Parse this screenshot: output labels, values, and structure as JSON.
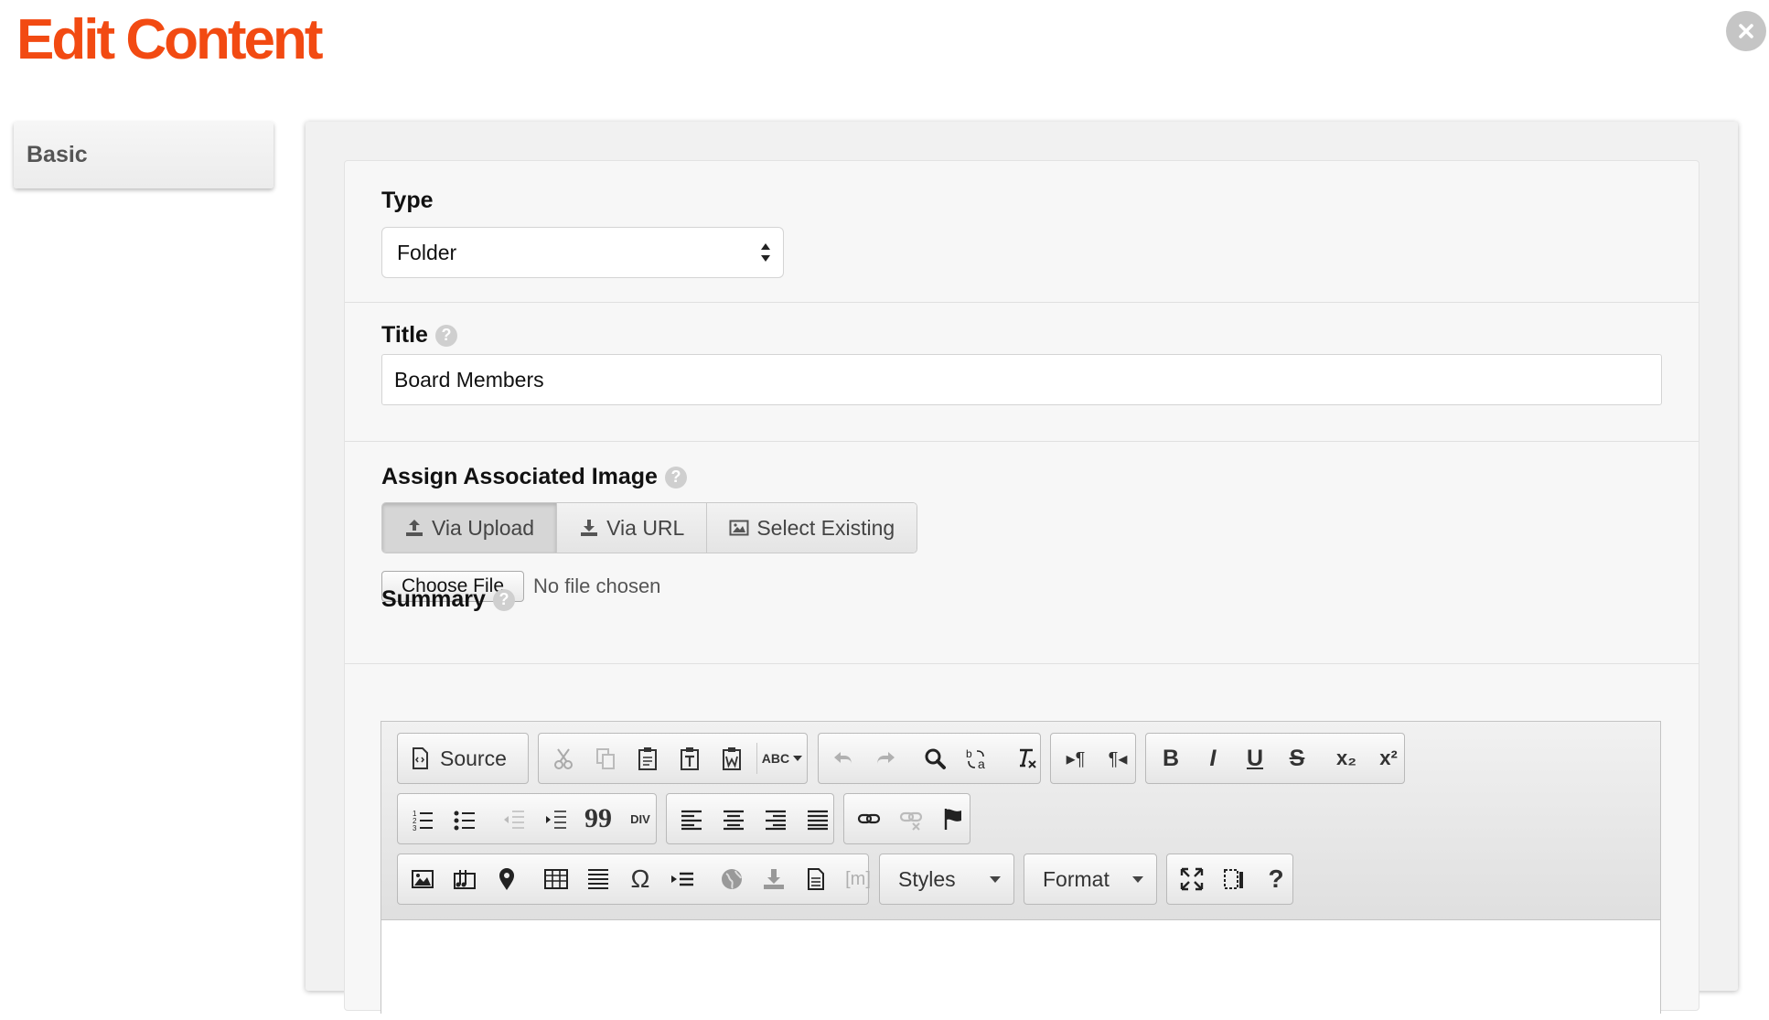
{
  "page": {
    "title": "Edit Content",
    "close_icon": "close-circle-icon",
    "accent_color": "#f24a12"
  },
  "sidebar": {
    "tabs": [
      {
        "label": "Basic"
      }
    ]
  },
  "form": {
    "type": {
      "label": "Type",
      "selected": "Folder"
    },
    "title": {
      "label": "Title",
      "value": "Board Members",
      "help": "?"
    },
    "image": {
      "label": "Assign Associated Image",
      "help": "?",
      "options": [
        {
          "label": "Via Upload",
          "icon": "upload-icon",
          "active": true
        },
        {
          "label": "Via URL",
          "icon": "download-icon",
          "active": false
        },
        {
          "label": "Select Existing",
          "icon": "image-icon",
          "active": false
        }
      ],
      "file_button": "Choose File",
      "file_status": "No file chosen"
    },
    "summary": {
      "label": "Summary",
      "help": "?",
      "toolbar": {
        "source_label": "Source",
        "styles_label": "Styles",
        "format_label": "Format",
        "help_label": "?",
        "bold_label": "B",
        "italic_label": "I",
        "underline_label": "U",
        "strike_label": "S",
        "subscript_label": "x₂",
        "superscript_label": "x²",
        "blockquote_label": "99",
        "special_char_label": "Ω",
        "div_label": "DIV",
        "media_label": "[m]",
        "rtl_label": "¶◂",
        "ltr_label": "▸¶",
        "spell_label": "ABC"
      }
    }
  }
}
